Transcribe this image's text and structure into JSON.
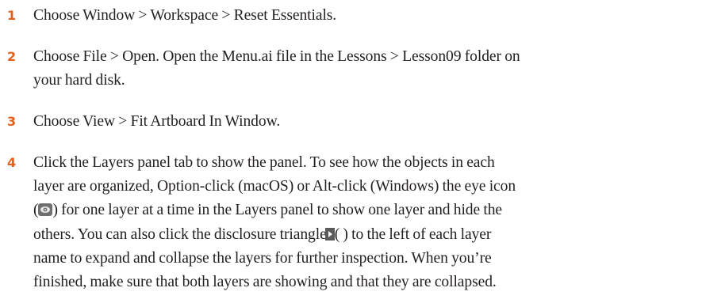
{
  "colors": {
    "step_number": "#e2611e",
    "text": "#231f20",
    "eye_icon_bg": "#6f6f6f",
    "eye_icon_fg": "#e6e6e6",
    "triangle_bg": "#5a5a5a",
    "triangle_fg": "#ffffff"
  },
  "steps": [
    {
      "number": "1",
      "lines": [
        "Choose Window > Workspace > Reset Essentials."
      ]
    },
    {
      "number": "2",
      "lines": [
        "Choose File > Open. Open the Menu.ai file in the Lessons > Lesson09 folder on",
        "your hard disk."
      ]
    },
    {
      "number": "3",
      "lines": [
        "Choose View > Fit Artboard In Window."
      ]
    },
    {
      "number": "4",
      "line1": "Click the Layers panel tab to show the panel. To see how the objects in each",
      "line2": "layer are organized, Option-click (macOS) or Alt-click (Windows) the eye icon",
      "line3_open": "(",
      "line3_rest": ") for one layer at a time in the Layers panel to show one layer and hide the",
      "line4_pre": "others. You can also click the disclosure triangle",
      "line4_post": "( ) to the left of each layer",
      "line5": "name to expand and collapse the layers for further inspection. When you’re",
      "line6": "finished, make sure that both layers are showing and that they are collapsed."
    }
  ],
  "icons": {
    "eye": "eye-icon",
    "disclosure": "disclosure-triangle-icon"
  }
}
